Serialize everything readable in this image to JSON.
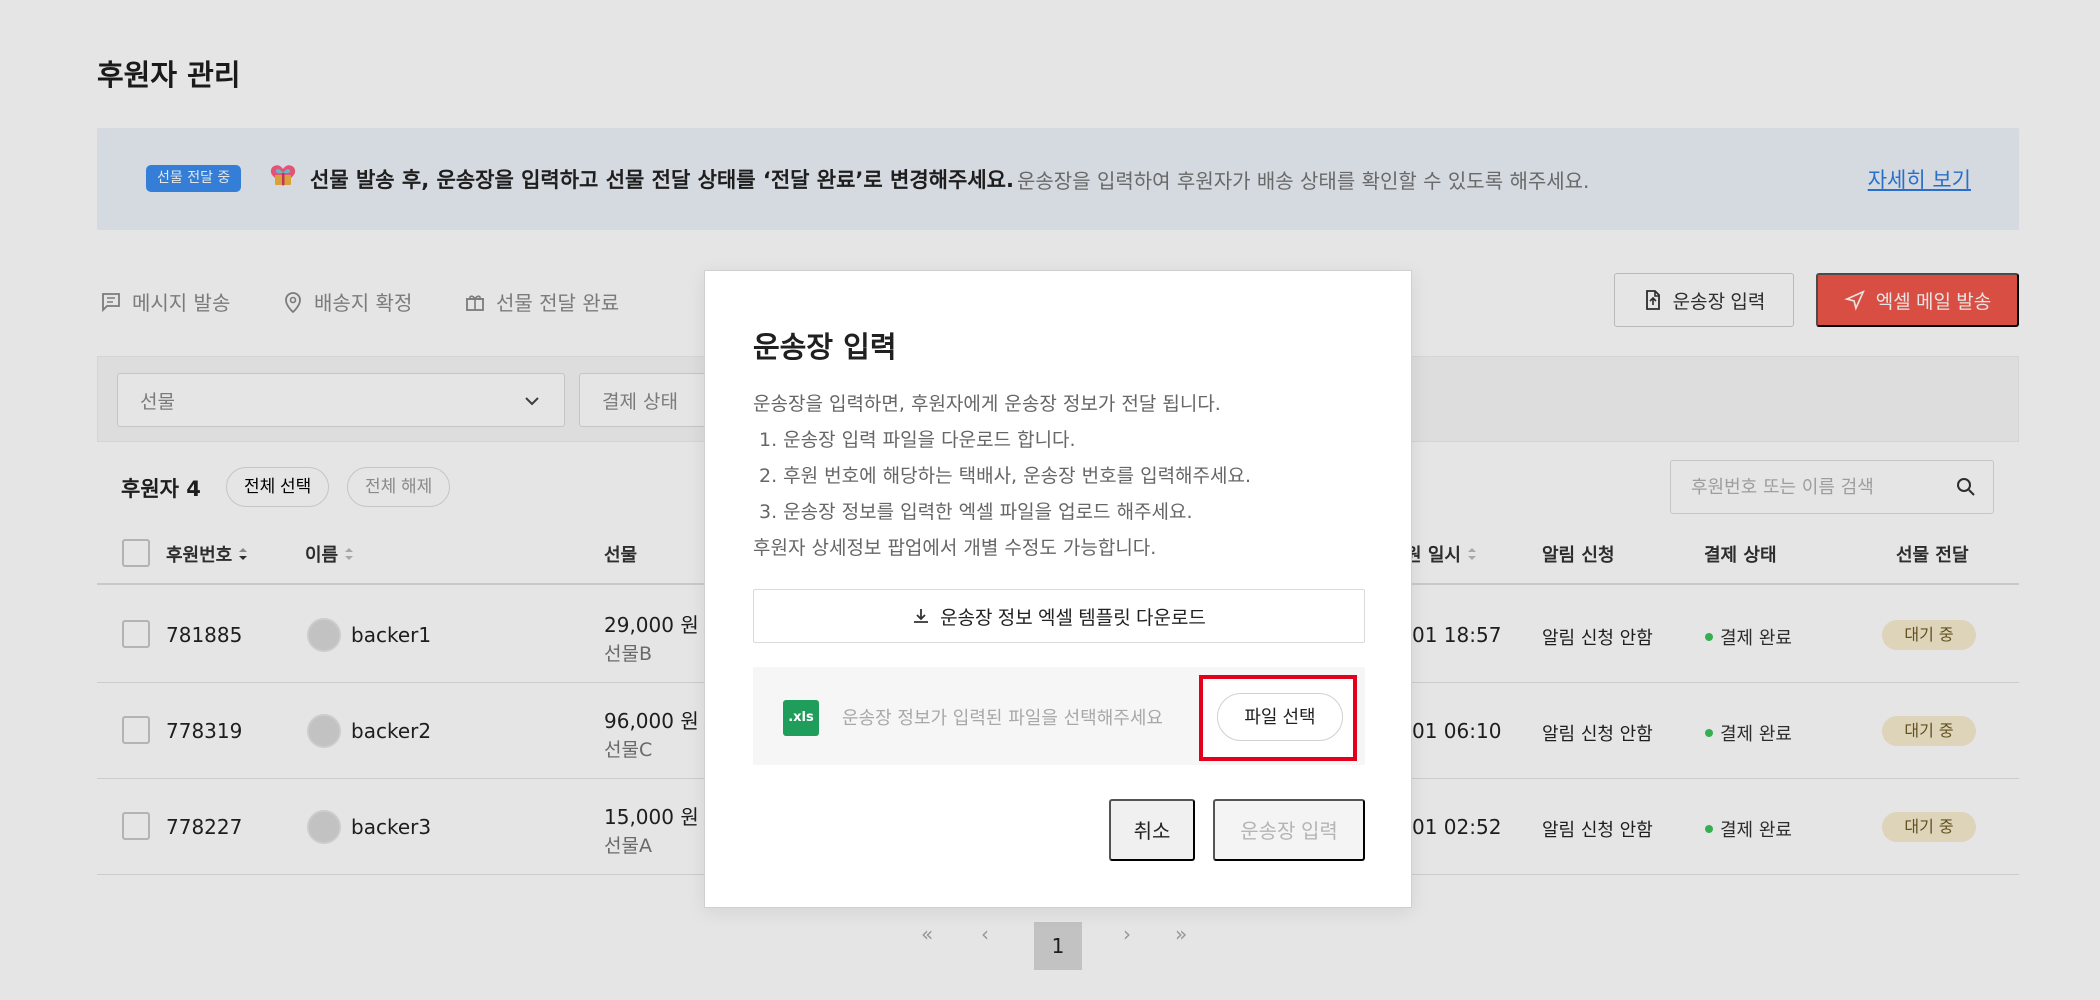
{
  "page": {
    "title": "후원자 관리",
    "background": "#ffffff"
  },
  "banner": {
    "badge": "선물 전달 중",
    "main_text": "선물 발송 후, 운송장을 입력하고 선물 전달 상태를 ‘전달 완료’로 변경해주세요.",
    "sub_text": "운송장을 입력하여 후원자가 배송 상태를 확인할 수 있도록 해주세요.",
    "link": "자세히 보기",
    "icon": "heart-gift-icon"
  },
  "toolbar": {
    "actions": [
      {
        "label": "메시지 발송",
        "icon": "message-icon"
      },
      {
        "label": "배송지 확정",
        "icon": "location-icon"
      },
      {
        "label": "선물 전달 완료",
        "icon": "gift-icon"
      }
    ],
    "tracking_button": "운송장 입력",
    "excel_button": "엑셀 메일 발송",
    "accent_color": "#f2574a"
  },
  "filters": {
    "gift": "선물",
    "payment_status": "결제 상태"
  },
  "list": {
    "count_label": "후원자 4",
    "select_all": "전체 선택",
    "deselect_all": "전체 해제",
    "search_placeholder": "후원번호 또는 이름 검색"
  },
  "table": {
    "columns": [
      "후원번호",
      "이름",
      "선물",
      "원 일시",
      "알림 신청",
      "결제 상태",
      "선물 전달"
    ],
    "rows": [
      {
        "number": "781885",
        "name": "backer1",
        "amount": "29,000 원",
        "gift": "선물B",
        "date": "01 18:57",
        "notification": "알림 신청 안함",
        "payment": "결제 완료",
        "delivery": "대기 중"
      },
      {
        "number": "778319",
        "name": "backer2",
        "amount": "96,000 원",
        "gift": "선물C",
        "date": "01 06:10",
        "notification": "알림 신청 안함",
        "payment": "결제 완료",
        "delivery": "대기 중"
      },
      {
        "number": "778227",
        "name": "backer3",
        "amount": "15,000 원",
        "gift": "선물A",
        "date": "01 02:52",
        "notification": "알림 신청 안함",
        "payment": "결제 완료",
        "delivery": "대기 중"
      }
    ]
  },
  "pagination": {
    "first": "«",
    "previous": "‹",
    "current": "1",
    "next": "›",
    "last": "»"
  },
  "modal": {
    "title": "운송장 입력",
    "intro": "운송장을 입력하면, 후원자에게 운송장 정보가 전달 됩니다.",
    "step1": "1. 운송장 입력 파일을 다운로드 합니다.",
    "step2": "2. 후원 번호에 해당하는 택배사, 운송장 번호를 입력해주세요.",
    "step3": "3. 운송장 정보를 입력한 엑셀 파일을 업로드 해주세요.",
    "note": "후원자 상세정보 팝업에서 개별 수정도 가능합니다.",
    "download_button": "운송장 정보 엑셀 템플릿 다운로드",
    "xls_label": ".xls",
    "upload_placeholder": "운송장 정보가 입력된 파일을 선택해주세요",
    "file_button": "파일 선택",
    "cancel_button": "취소",
    "submit_button": "운송장 입력",
    "highlight_color": "#e2001a"
  }
}
